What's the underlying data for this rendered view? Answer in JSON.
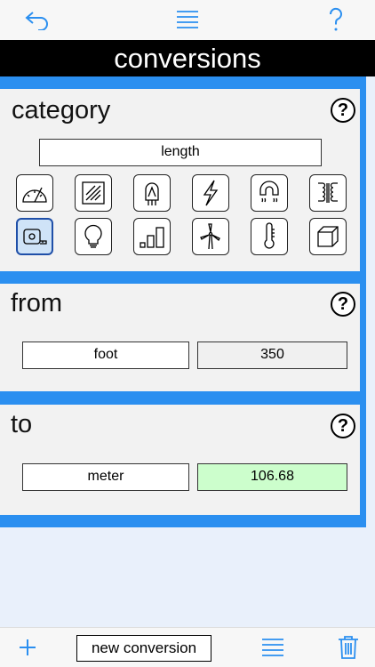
{
  "header": {
    "title": "conversions",
    "back_icon": "undo-arrow-icon",
    "menu_icon": "list-icon",
    "help_icon": "question-icon",
    "accent_color": "#2b8ff0"
  },
  "category": {
    "title": "category",
    "help": "?",
    "selected": "length",
    "icons": [
      "protractor-icon",
      "area-icon",
      "vacuum-tube-icon",
      "lightning-icon",
      "magnet-icon",
      "transformer-icon",
      "tape-measure-icon",
      "light-bulb-icon",
      "bar-chart-icon",
      "wind-turbine-icon",
      "thermometer-icon",
      "cube-icon"
    ],
    "selected_icon": "tape-measure-icon"
  },
  "from": {
    "title": "from",
    "help": "?",
    "unit": "foot",
    "value": "350"
  },
  "to": {
    "title": "to",
    "help": "?",
    "unit": "meter",
    "value": "106.68",
    "result_color": "#ccfecc"
  },
  "bottom": {
    "add_icon": "plus-icon",
    "new_conversion": "new conversion",
    "list_icon": "list-icon",
    "trash_icon": "trash-icon"
  }
}
